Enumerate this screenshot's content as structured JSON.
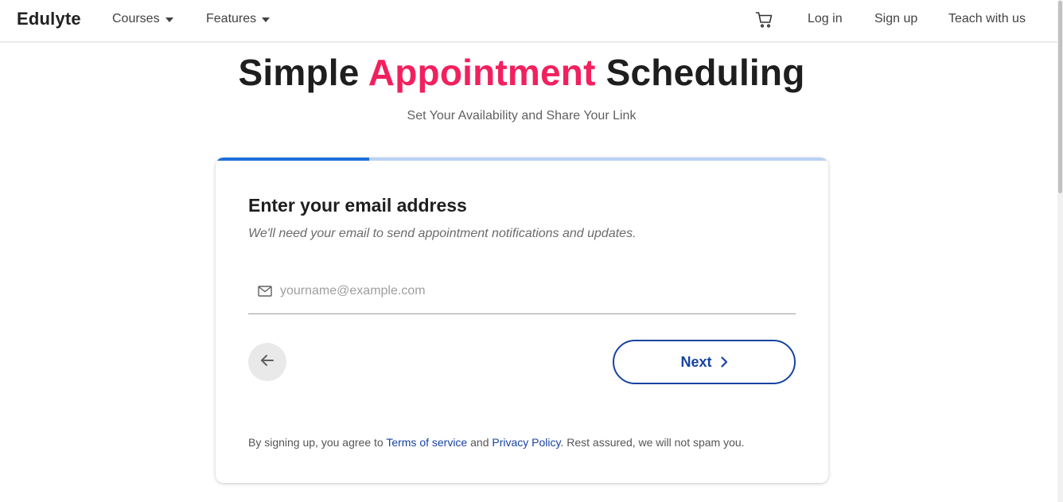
{
  "nav": {
    "brand": "Edulyte",
    "courses_label": "Courses",
    "features_label": "Features",
    "login_label": "Log in",
    "signup_label": "Sign up",
    "teach_label": "Teach with us",
    "cart_icon": "shopping-cart-icon"
  },
  "hero": {
    "title_part1": "Simple ",
    "title_accent": "Appointment",
    "title_part2": " Scheduling",
    "subtitle": "Set Your Availability and Share Your Link",
    "accent_color": "#f2205e"
  },
  "form": {
    "progress": 0.25,
    "step_title": "Enter your email address",
    "step_description": "We'll need your email to send appointment notifications and updates.",
    "email_value": "",
    "email_placeholder": "yourname@example.com",
    "next_label": "Next",
    "back_icon": "arrow-left-icon"
  },
  "legal": {
    "prefix": "By signing up, you agree to ",
    "terms_label": "Terms of service",
    "and": " and ",
    "privacy_label": "Privacy Policy",
    "suffix": ". Rest assured, we will not spam you."
  },
  "colors": {
    "primary": "#1843a0",
    "progress_fill": "#1e6fd9",
    "progress_track": "#b9d2f3"
  }
}
